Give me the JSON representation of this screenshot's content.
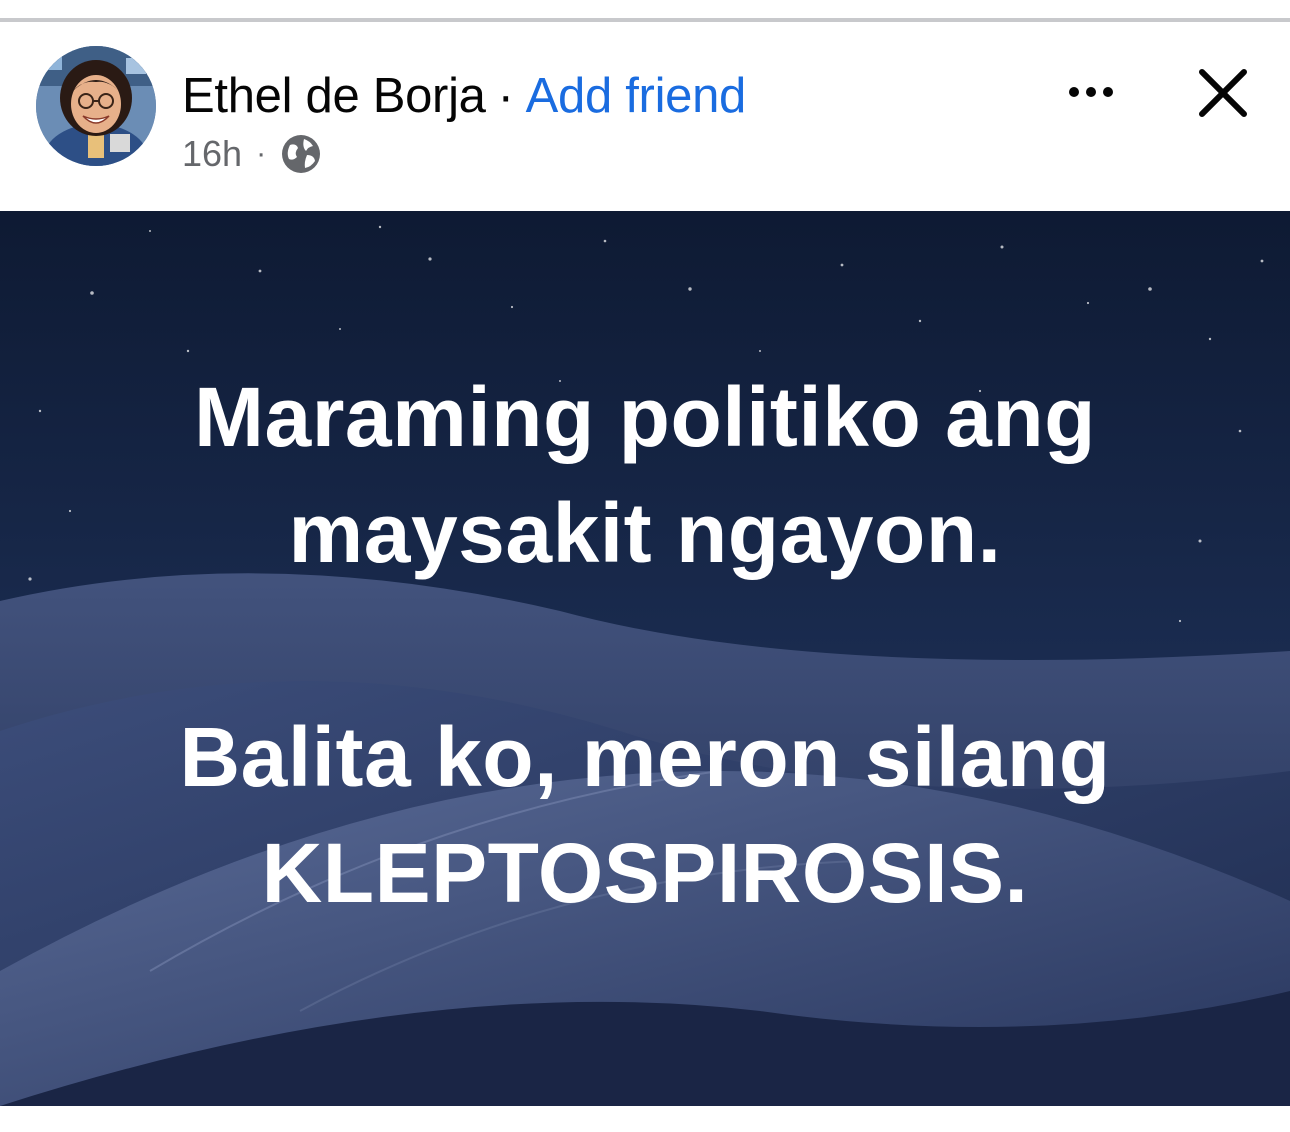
{
  "post": {
    "author_name": "Ethel de Borja",
    "separator": "·",
    "add_friend_label": "Add friend",
    "time": "16h",
    "meta_separator": "·",
    "privacy_icon": "globe-icon",
    "more_icon": "more-options-icon",
    "close_icon": "close-icon"
  },
  "image_text": {
    "line1": "Maraming politiko ang",
    "line2": "maysakit ngayon.",
    "line3": "Balita ko, meron silang",
    "line4": "KLEPTOSPIROSIS."
  },
  "colors": {
    "link_blue": "#1a6ce0",
    "meta_gray": "#65676b",
    "night_sky": "#0f1a33"
  }
}
